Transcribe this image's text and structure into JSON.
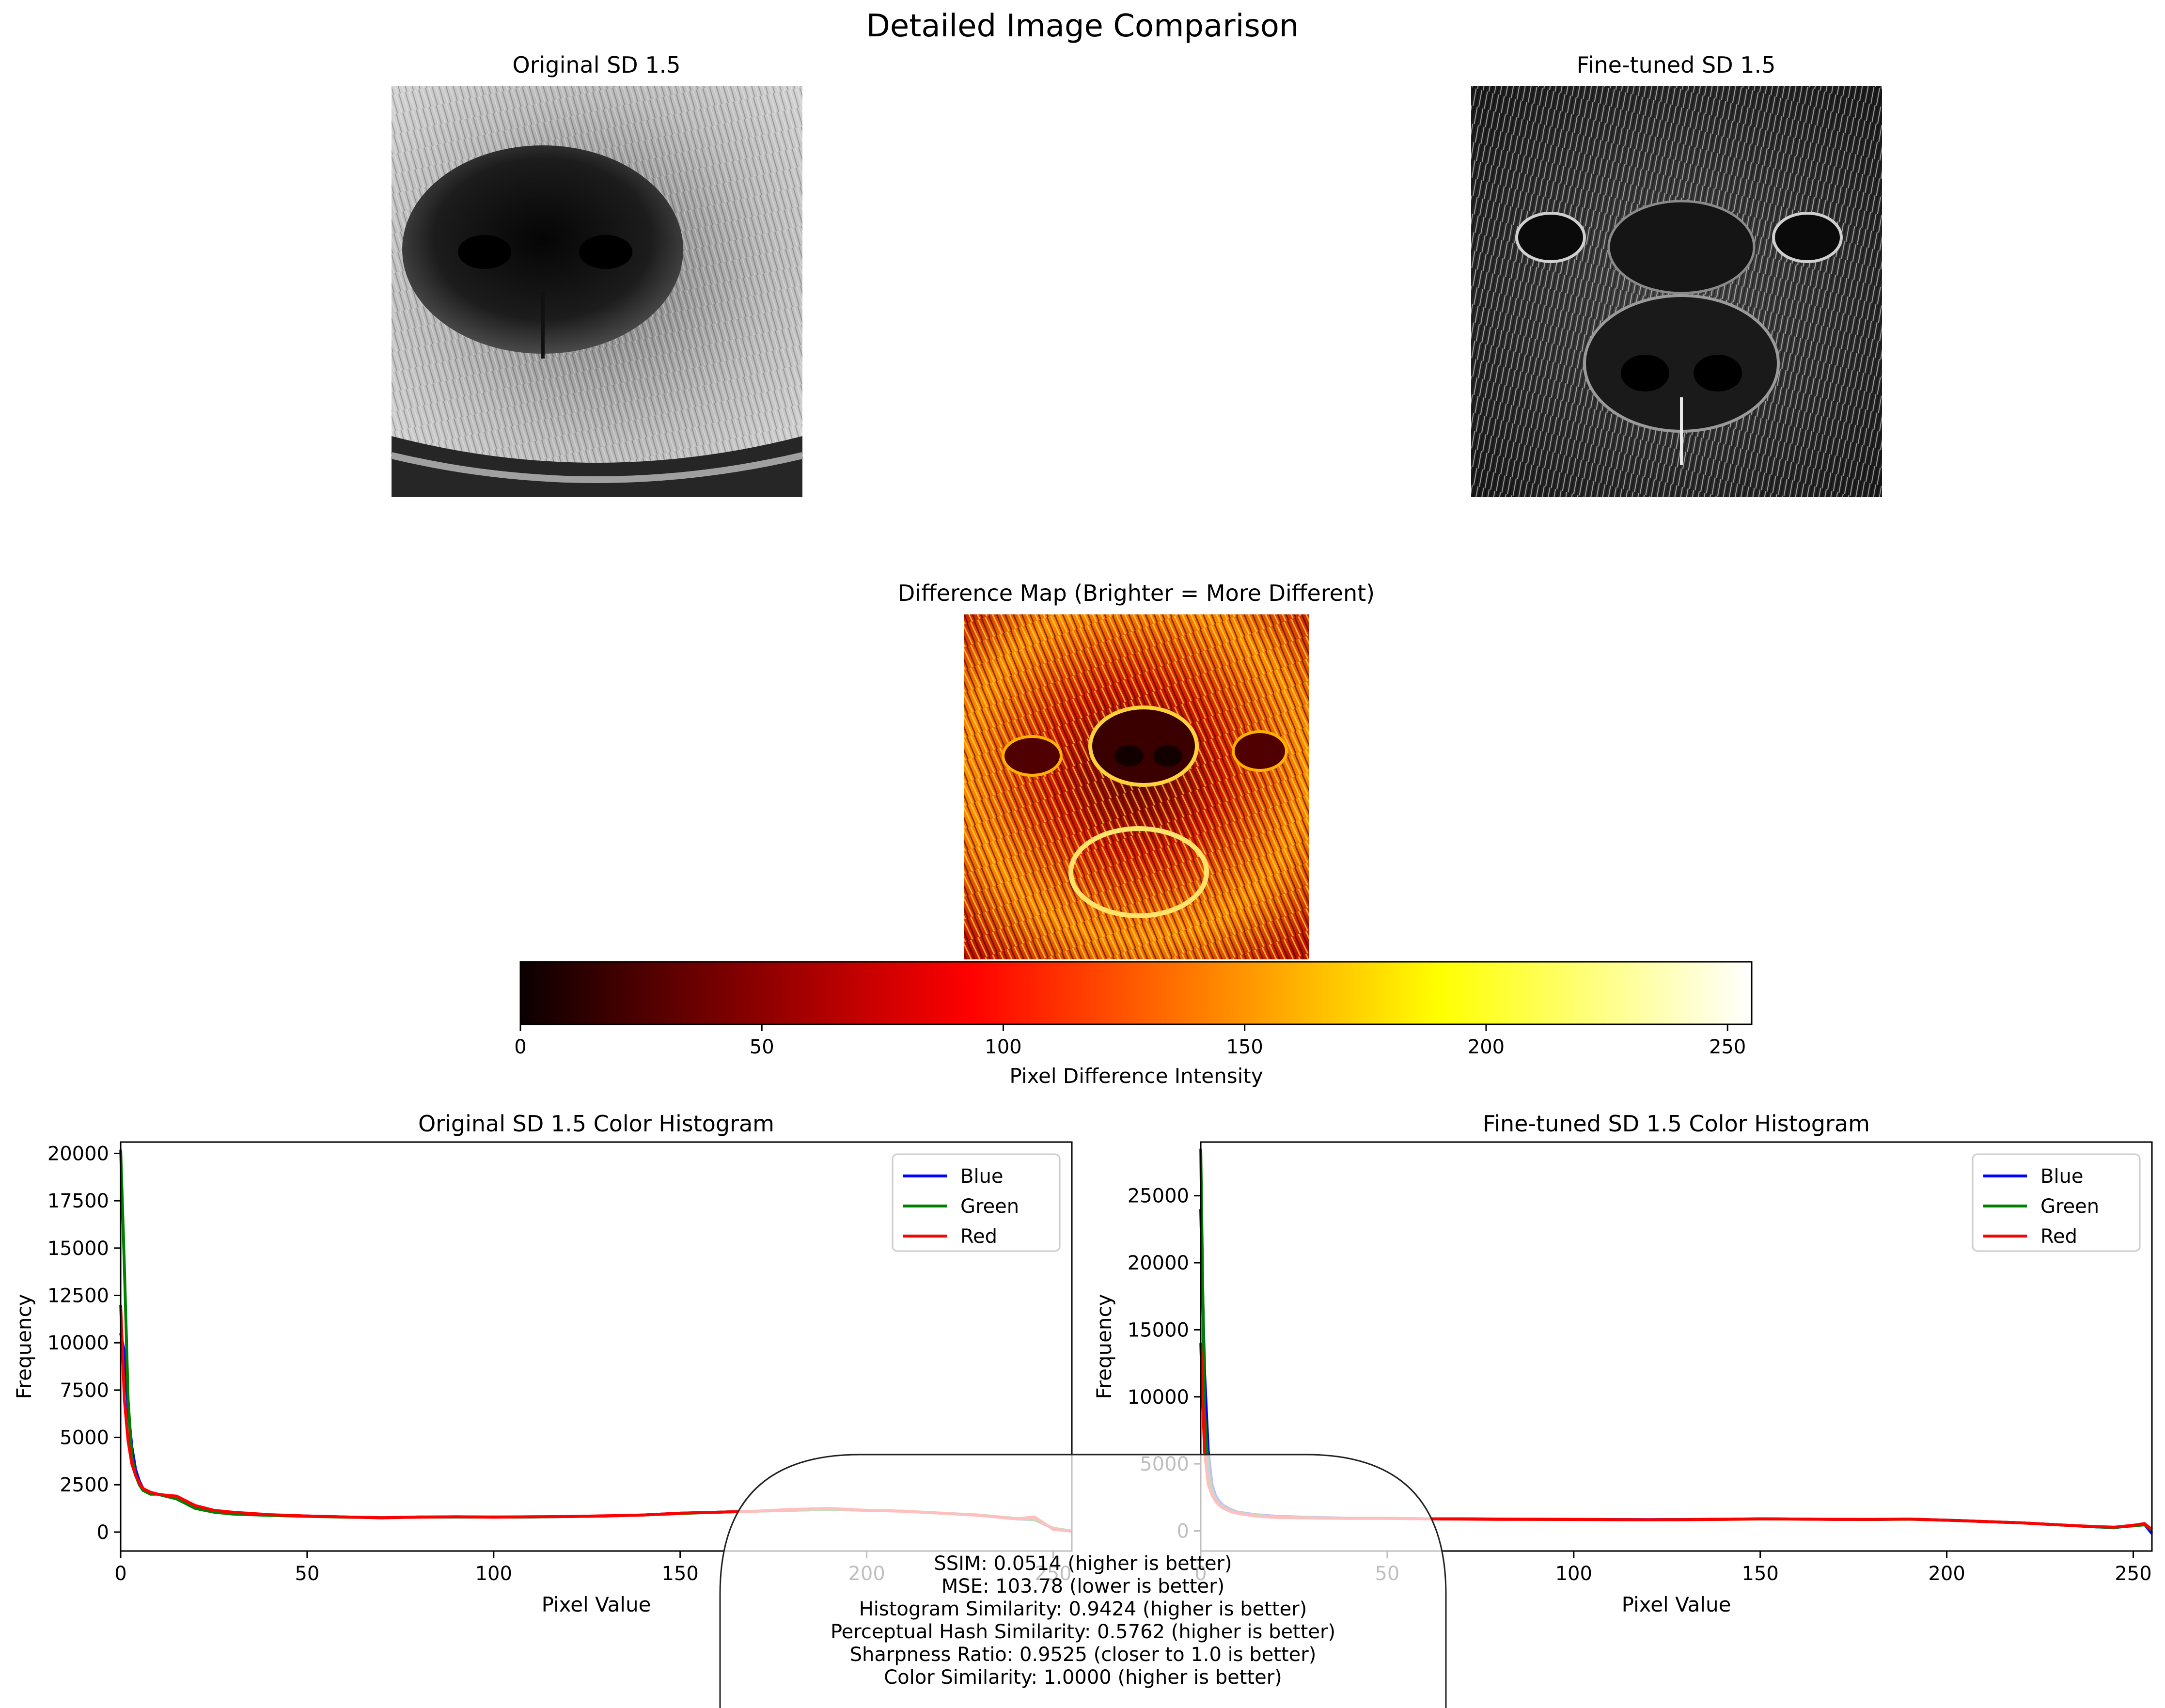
{
  "figure": {
    "title": "Detailed Image Comparison"
  },
  "images": {
    "original_title": "Original SD 1.5",
    "finetuned_title": "Fine-tuned SD 1.5",
    "difference_title": "Difference Map (Brighter = More Different)"
  },
  "colorbar": {
    "label": "Pixel Difference Intensity",
    "ticks": [
      "0",
      "50",
      "100",
      "150",
      "200",
      "250"
    ],
    "range": [
      0,
      255
    ],
    "colormap": "hot"
  },
  "colors": {
    "blue": "#0000ff",
    "green": "#008000",
    "red": "#ff0000"
  },
  "chart_data": [
    {
      "type": "line",
      "title": "Original SD 1.5 Color Histogram",
      "xlabel": "Pixel Value",
      "ylabel": "Frequency",
      "xlim": [
        0,
        255
      ],
      "ylim": [
        -1000,
        20600
      ],
      "xticks": [
        "0",
        "50",
        "100",
        "150",
        "200",
        "250"
      ],
      "yticks": [
        "0",
        "2500",
        "5000",
        "7500",
        "10000",
        "12500",
        "15000",
        "17500",
        "20000"
      ],
      "legend": "top-right",
      "series": [
        {
          "name": "Blue",
          "color": "#0000ff",
          "x": [
            0,
            1,
            2,
            3,
            4,
            5,
            6,
            8,
            10,
            12,
            15,
            18,
            20,
            25,
            30,
            40,
            50,
            60,
            70,
            80,
            90,
            100,
            110,
            120,
            130,
            140,
            150,
            160,
            170,
            180,
            190,
            200,
            210,
            220,
            230,
            240,
            245,
            250,
            255
          ],
          "y": [
            10500,
            9500,
            6500,
            4500,
            3300,
            2700,
            2300,
            2100,
            2000,
            1900,
            1800,
            1500,
            1300,
            1100,
            1000,
            900,
            850,
            800,
            750,
            800,
            800,
            800,
            800,
            820,
            850,
            900,
            1000,
            1050,
            1100,
            1150,
            1200,
            1150,
            1100,
            1000,
            900,
            700,
            650,
            200,
            50
          ]
        },
        {
          "name": "Green",
          "color": "#008000",
          "x": [
            0,
            1,
            2,
            3,
            4,
            5,
            6,
            8,
            10,
            12,
            15,
            18,
            20,
            25,
            30,
            40,
            50,
            60,
            70,
            80,
            90,
            100,
            110,
            120,
            130,
            140,
            150,
            160,
            170,
            180,
            190,
            200,
            210,
            220,
            230,
            240,
            245,
            250,
            255
          ],
          "y": [
            20200,
            14000,
            7000,
            4000,
            3000,
            2500,
            2200,
            2000,
            2000,
            1900,
            1750,
            1450,
            1250,
            1050,
            950,
            880,
            830,
            790,
            760,
            790,
            800,
            790,
            800,
            820,
            850,
            900,
            980,
            1050,
            1100,
            1150,
            1200,
            1150,
            1100,
            1000,
            900,
            720,
            650,
            200,
            50
          ]
        },
        {
          "name": "Red",
          "color": "#ff0000",
          "x": [
            0,
            1,
            2,
            3,
            4,
            5,
            6,
            8,
            10,
            12,
            15,
            18,
            20,
            25,
            30,
            40,
            50,
            60,
            70,
            80,
            90,
            100,
            110,
            120,
            130,
            140,
            150,
            160,
            170,
            180,
            190,
            200,
            210,
            220,
            230,
            240,
            245,
            250,
            255
          ],
          "y": [
            12000,
            7000,
            4800,
            3600,
            3000,
            2600,
            2300,
            2100,
            2000,
            1950,
            1900,
            1600,
            1400,
            1150,
            1050,
            920,
            850,
            800,
            760,
            790,
            810,
            790,
            810,
            820,
            860,
            900,
            1000,
            1050,
            1100,
            1200,
            1250,
            1150,
            1100,
            1000,
            880,
            700,
            800,
            150,
            50
          ]
        }
      ]
    },
    {
      "type": "line",
      "title": "Fine-tuned SD 1.5 Color Histogram",
      "xlabel": "Pixel Value",
      "ylabel": "Frequency",
      "xlim": [
        0,
        255
      ],
      "ylim": [
        -1500,
        29000
      ],
      "xticks": [
        "0",
        "50",
        "100",
        "150",
        "200",
        "250"
      ],
      "yticks": [
        "0",
        "5000",
        "10000",
        "15000",
        "20000",
        "25000"
      ],
      "legend": "top-right",
      "series": [
        {
          "name": "Blue",
          "color": "#0000ff",
          "x": [
            0,
            1,
            2,
            3,
            4,
            5,
            6,
            8,
            10,
            15,
            20,
            30,
            40,
            50,
            60,
            70,
            80,
            90,
            100,
            110,
            120,
            130,
            140,
            150,
            160,
            170,
            180,
            190,
            200,
            210,
            220,
            230,
            240,
            245,
            250,
            253,
            255
          ],
          "y": [
            24000,
            12000,
            6000,
            3500,
            2600,
            2200,
            1900,
            1600,
            1400,
            1200,
            1100,
            1000,
            950,
            950,
            900,
            900,
            880,
            870,
            860,
            850,
            840,
            850,
            870,
            900,
            880,
            860,
            850,
            880,
            800,
            700,
            600,
            450,
            300,
            250,
            400,
            500,
            -200
          ]
        },
        {
          "name": "Green",
          "color": "#008000",
          "x": [
            0,
            1,
            2,
            3,
            4,
            5,
            6,
            8,
            10,
            15,
            20,
            30,
            40,
            50,
            60,
            70,
            80,
            90,
            100,
            110,
            120,
            130,
            140,
            150,
            160,
            170,
            180,
            190,
            200,
            210,
            220,
            230,
            240,
            245,
            250,
            253,
            255
          ],
          "y": [
            28500,
            9000,
            4500,
            3000,
            2400,
            2000,
            1800,
            1500,
            1350,
            1150,
            1050,
            980,
            940,
            940,
            900,
            890,
            870,
            860,
            850,
            840,
            830,
            840,
            860,
            890,
            880,
            860,
            850,
            870,
            800,
            700,
            600,
            450,
            300,
            260,
            380,
            450,
            50
          ]
        },
        {
          "name": "Red",
          "color": "#ff0000",
          "x": [
            0,
            1,
            2,
            3,
            4,
            5,
            6,
            8,
            10,
            15,
            20,
            30,
            40,
            50,
            60,
            70,
            80,
            90,
            100,
            110,
            120,
            130,
            140,
            150,
            160,
            170,
            180,
            190,
            200,
            210,
            220,
            230,
            240,
            245,
            250,
            253,
            255
          ],
          "y": [
            14000,
            6000,
            3500,
            2700,
            2200,
            1900,
            1700,
            1450,
            1300,
            1100,
            1000,
            960,
            930,
            930,
            900,
            880,
            860,
            860,
            850,
            840,
            830,
            840,
            860,
            900,
            880,
            860,
            860,
            880,
            800,
            700,
            600,
            450,
            320,
            280,
            420,
            550,
            100
          ]
        }
      ]
    }
  ],
  "metrics": [
    "SSIM: 0.0514 (higher is better)",
    "MSE: 103.78 (lower is better)",
    "Histogram Similarity: 0.9424 (higher is better)",
    "Perceptual Hash Similarity: 0.5762 (higher is better)",
    "Sharpness Ratio: 0.9525 (closer to 1.0 is better)",
    "Color Similarity: 1.0000 (higher is better)"
  ]
}
